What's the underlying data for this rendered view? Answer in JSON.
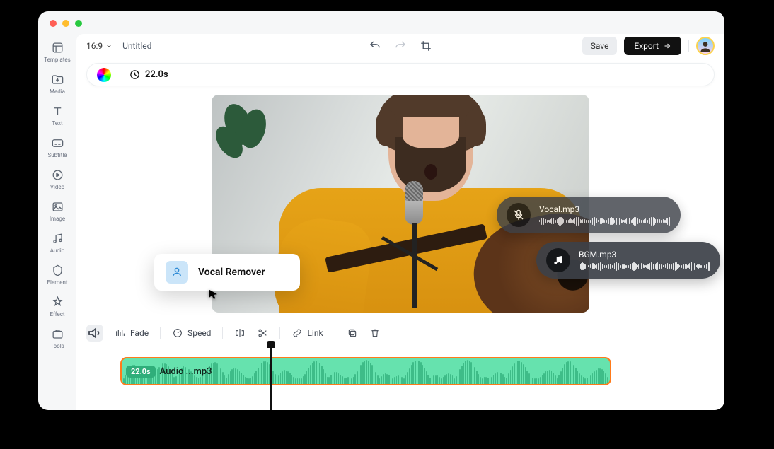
{
  "header": {
    "aspect": "16:9",
    "title": "Untitled",
    "save": "Save",
    "export": "Export"
  },
  "info": {
    "time": "22.0s"
  },
  "sidebar": {
    "items": [
      {
        "label": "Templates"
      },
      {
        "label": "Media"
      },
      {
        "label": "Text"
      },
      {
        "label": "Subtitle"
      },
      {
        "label": "Video"
      },
      {
        "label": "Image"
      },
      {
        "label": "Audio"
      },
      {
        "label": "Element"
      },
      {
        "label": "Effect"
      },
      {
        "label": "Tools"
      }
    ]
  },
  "popup": {
    "label": "Vocal Remover"
  },
  "toasts": {
    "vocal": "Vocal.mp3",
    "bgm": "BGM.mp3"
  },
  "toolbar2": {
    "fade": "Fade",
    "speed": "Speed",
    "link": "Link"
  },
  "clip": {
    "badge": "22.0s",
    "name": "Audio ...mp3"
  }
}
